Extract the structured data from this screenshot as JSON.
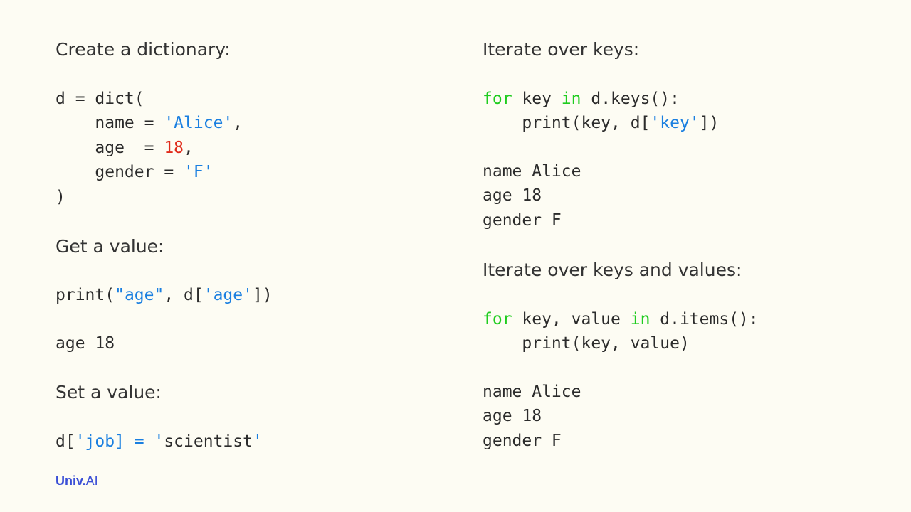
{
  "left": {
    "create_heading": "Create a dictionary:",
    "create_code": {
      "l1": "d = dict(",
      "l2_pre": "    name = ",
      "l2_str": "'Alice'",
      "l2_post": ",",
      "l3_pre": "    age  = ",
      "l3_num": "18",
      "l3_post": ",",
      "l4_pre": "    gender = ",
      "l4_str": "'F'",
      "l5": ")"
    },
    "get_heading": "Get a value:",
    "get_code": {
      "pre": "print(",
      "s1": "\"age\"",
      "mid": ", d[",
      "s2": "'age'",
      "post": "])"
    },
    "get_output": "age 18",
    "set_heading": "Set a value:",
    "set_code": {
      "pre": "d[",
      "s1": "'job] = '",
      "post": "scientist",
      "s2": "'"
    }
  },
  "right": {
    "keys_heading": "Iterate over keys:",
    "keys_code": {
      "kw1": "for",
      "t1": " key ",
      "kw2": "in",
      "t2": " d.keys():",
      "l2_pre": "    print(key, d[",
      "l2_str": "'key'",
      "l2_post": "])"
    },
    "keys_output": [
      "name Alice",
      "age 18",
      "gender F"
    ],
    "items_heading": "Iterate over keys and values:",
    "items_code": {
      "kw1": "for",
      "t1": " key, value ",
      "kw2": "in",
      "t2": " d.items():",
      "l2": "    print(key, value)"
    },
    "items_output": [
      "name Alice",
      "age 18",
      "gender F"
    ]
  },
  "logo": {
    "main": "Univ.",
    "suffix": "AI"
  },
  "colors": {
    "background": "#fdfcf3",
    "string": "#1a7fe0",
    "number": "#e02a1a",
    "keyword": "#1fcc1f",
    "logo": "#3a4fd6"
  }
}
